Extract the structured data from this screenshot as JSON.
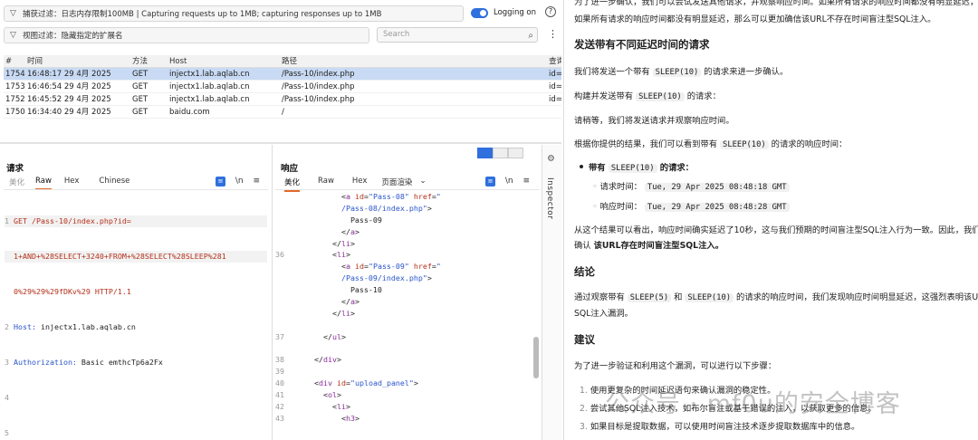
{
  "filters": {
    "capture": "捕获过滤：日志内存限制100MB | Capturing requests up to 1MB;  capturing responses up to 1MB",
    "view": "视图过滤：隐藏指定的扩展名",
    "logging": "Logging on",
    "search_placeholder": "Search"
  },
  "table": {
    "headers": [
      "#",
      "时间",
      "方法",
      "Host",
      "路径",
      "查询"
    ],
    "rows": [
      {
        "num": "1754",
        "time": "16:48:17 29 4月 2025",
        "method": "GET",
        "host": "injectx1.lab.aqlab.cn",
        "path": "/Pass-10/index.php",
        "q": "id="
      },
      {
        "num": "1753",
        "time": "16:46:54 29 4月 2025",
        "method": "GET",
        "host": "injectx1.lab.aqlab.cn",
        "path": "/Pass-10/index.php",
        "q": "id="
      },
      {
        "num": "1752",
        "time": "16:45:52 29 4月 2025",
        "method": "GET",
        "host": "injectx1.lab.aqlab.cn",
        "path": "/Pass-10/index.php",
        "q": "id="
      },
      {
        "num": "1750",
        "time": "16:34:40 29 4月 2025",
        "method": "GET",
        "host": "baidu.com",
        "path": "/",
        "q": ""
      }
    ]
  },
  "request": {
    "title": "请求",
    "tabs": [
      "美化",
      "Raw",
      "Hex",
      "Chinese"
    ],
    "lines": {
      "l1a": "GET /Pass-10/index.php?id=",
      "l1b": "1+AND+%28SELECT+3240+FROM+%28SELECT%28SLEEP%281",
      "l1c": "0%29%29%29fDKv%29 HTTP/1.1",
      "l2k": "Host:",
      "l2v": " injectx1.lab.aqlab.cn",
      "l3k": "Authorization:",
      "l3v": " Basic emthcTp6a2Fx"
    }
  },
  "response": {
    "title": "响应",
    "tabs": [
      "美化",
      "Raw",
      "Hex",
      "页面渲染"
    ],
    "line_numbers": [
      "",
      "",
      "",
      "",
      "",
      "36",
      "",
      "",
      "",
      "",
      "",
      "37",
      "",
      "38",
      "39",
      "40",
      "41",
      "42",
      "43"
    ]
  },
  "inspector": "Inspector",
  "article": {
    "top1": "为了进一步确认，我们可以尝试发送其他请求，并观察响应时间。如果所有请求的响应时间都没有明显延迟，那么可以更加确信该URL不存在时间盲注型SQL注入。",
    "top2": "如果所有请求的响应时间都没有明显延迟，那么可以更加确信该URL不存在时间盲注型SQL注入。",
    "h1": "发送带有不同延迟时间的请求",
    "p1a": "我们将发送一个带有",
    "p1code": "SLEEP(10)",
    "p1b": "的请求来进一步确认。",
    "p2a": "构建并发送带有",
    "p2code": "SLEEP(10)",
    "p2b": "的请求：",
    "p3": "请稍等，我们将发送请求并观察响应时间。",
    "p4a": "根据你提供的结果，我们可以看到带有",
    "p4code": "SLEEP(10)",
    "p4b": "的请求的响应时间：",
    "b1a": "带有",
    "b1code": "SLEEP(10)",
    "b1b": "的请求：",
    "s1label": "请求时间：",
    "s1val": "Tue, 29 Apr 2025 08:48:18 GMT",
    "s2label": "响应时间：",
    "s2val": "Tue, 29 Apr 2025 08:48:28 GMT",
    "p5": "从这个结果可以看出，响应时间确实延迟了10秒，这与我们预期的时间盲注型SQL注入行为一致。因此，我们可以",
    "p6a": "确认",
    "p6b": "该URL存在时间盲注型SQL注入。",
    "h2": "结论",
    "p7a": "通过观察带有",
    "p7code1": "SLEEP(5)",
    "p7and": "和",
    "p7code2": "SLEEP(10)",
    "p7b": "的请求的响应时间，我们发现响应时间明显延迟，这强烈表明该URL存在时间盲注型",
    "p8": "SQL注入漏洞。",
    "h3": "建议",
    "p9": "为了进一步验证和利用这个漏洞，可以进行以下步骤：",
    "o1": "使用更复杂的时间延迟语句来确认漏洞的稳定性。",
    "o2": "尝试其他SQL注入技术，如布尔盲注或基于错误的注入，以获取更多的信息。",
    "o3": "如果目标是提取数据，可以使用时间盲注技术逐步提取数据库中的信息。"
  },
  "watermark": "公众号 · mf0u的安全博客"
}
